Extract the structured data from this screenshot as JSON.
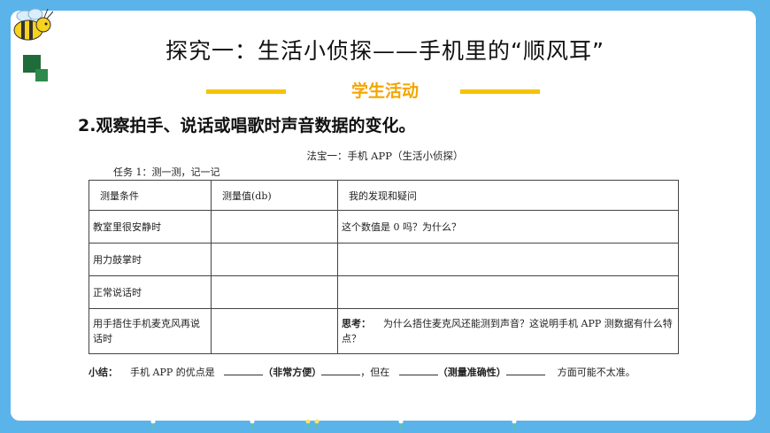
{
  "title": "探究一：生活小侦探——手机里的“顺风耳”",
  "subtitle": "学生活动",
  "heading": "2.观察拍手、说话或唱歌时声音数据的变化。",
  "fabao": "法宝一：手机 APP（生活小侦探）",
  "task": "任务 1：测一测，记一记",
  "table": {
    "headers": [
      "测量条件",
      "测量值(db)",
      "我的发现和疑问"
    ],
    "rows": [
      {
        "condition": "教室里很安静时",
        "value": "",
        "note": "这个数值是 0 吗？为什么？"
      },
      {
        "condition": "用力鼓掌时",
        "value": "",
        "note": ""
      },
      {
        "condition": "正常说话时",
        "value": "",
        "note": ""
      },
      {
        "condition": "用手捂住手机麦克风再说话时",
        "value": "",
        "note_label": "思考：",
        "note": "为什么捂住麦克风还能测到声音？这说明手机 APP 测数据有什么特点？"
      }
    ]
  },
  "summary": {
    "label": "小结：",
    "part1": "手机 APP 的优点是",
    "hint1": "（非常方便）",
    "part2": "，但在",
    "hint2": "（测量准确性）",
    "part3": "方面可能不太准。"
  },
  "colors": {
    "background": "#5ab4ea",
    "accent_yellow": "#f5c300",
    "subtitle": "#f5a500",
    "green": "#1f6b3a"
  }
}
